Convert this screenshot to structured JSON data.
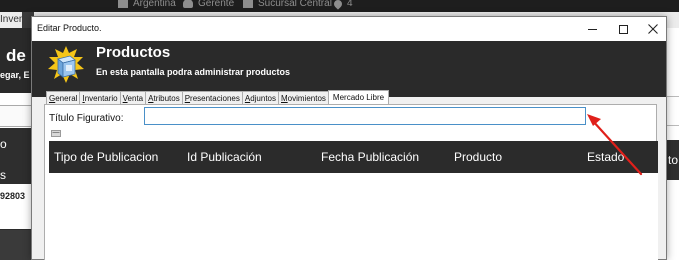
{
  "background_app": {
    "top_items": [
      "Argentina",
      "Gerente",
      "Sucursal Central",
      "4"
    ],
    "row2_text": "Inventa",
    "header_title": "de F",
    "header_subtitle": "egar, E",
    "col_text_1": "o",
    "col_text_2": "s",
    "cell_value": "92803",
    "right_col_text": "to"
  },
  "window": {
    "title": "Editar Producto.",
    "minimize_glyph": "—",
    "maximize_glyph": "☐",
    "close_glyph": "✕"
  },
  "header": {
    "title": "Productos",
    "subtitle": "En esta pantalla podra administrar productos"
  },
  "tabs": [
    "General",
    "Inventario",
    "Venta",
    "Atributos",
    "Presentaciones",
    "Adjuntos",
    "Movimientos",
    "Mercado Libre"
  ],
  "active_tab": "Mercado Libre",
  "form": {
    "titulo_label": "Título Figurativo:",
    "titulo_value": "",
    "collapse_glyph": "—"
  },
  "grid": {
    "columns": [
      "Tipo de Publicacion",
      "Id Publicación",
      "Fecha Publicación",
      "Producto",
      "Estado"
    ],
    "rows": []
  },
  "annotation": {
    "arrow_color": "#e0201b"
  }
}
